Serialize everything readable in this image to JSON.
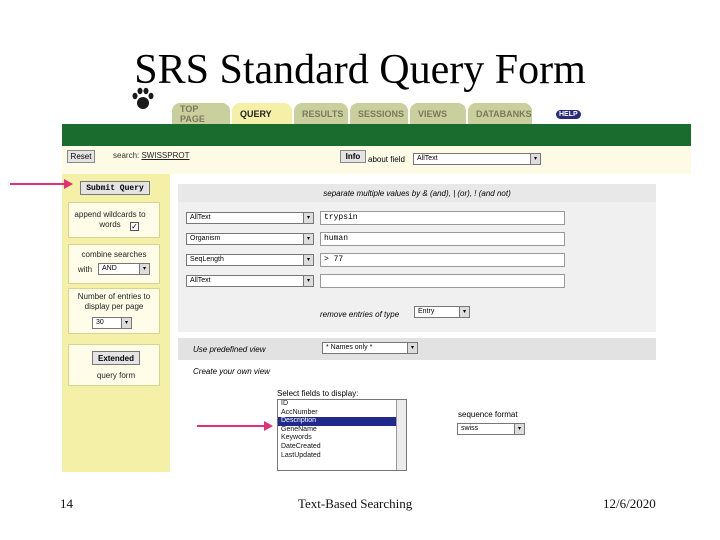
{
  "slide": {
    "title": "SRS Standard Query Form",
    "page_number": "14",
    "center_text": "Text-Based Searching",
    "date": "12/6/2020"
  },
  "tabs": [
    "TOP PAGE",
    "QUERY",
    "RESULTS",
    "SESSIONS",
    "VIEWS",
    "DATABANKS"
  ],
  "help_label": "HELP",
  "topbar": {
    "reset_label": "Reset",
    "search_prefix": "search:",
    "search_db": "SWISSPROT",
    "info_label": "Info",
    "about_field_label": "about field",
    "about_field_value": "AllText"
  },
  "sidebar": {
    "submit_label": "Submit Query",
    "append_wildcards_label": "append wildcards to words",
    "append_wildcards_checked": "✓",
    "combine_label": "combine searches",
    "combine_with_label": "with",
    "combine_value": "AND",
    "entries_label": "Number of entries to display per page",
    "entries_value": "30",
    "extended_label": "Extended",
    "extended_suffix": "query form"
  },
  "query": {
    "hint": "separate multiple values by & (and), | (or), ! (and not)",
    "rows": [
      {
        "field": "AllText",
        "value": "trypsin"
      },
      {
        "field": "Organism",
        "value": "human"
      },
      {
        "field": "SeqLength",
        "value": "> 77"
      },
      {
        "field": "AllText",
        "value": ""
      }
    ],
    "remove_label": "remove entries of type",
    "remove_value": "Entry"
  },
  "view": {
    "predefined_label": "Use predefined view",
    "predefined_value": "* Names only *",
    "create_label": "Create your own view",
    "select_fields_label": "Select fields to display:",
    "fields": [
      "ID",
      "AccNumber",
      "Description",
      "GeneName",
      "Keywords",
      "DateCreated",
      "LastUpdated"
    ],
    "selected_field_index": 2,
    "seq_format_label": "sequence format",
    "seq_format_value": "swiss"
  },
  "colors": {
    "green_bar": "#1a6b2e",
    "sidebar_yellow": "#f4f0a8",
    "arrow_pink": "#e0307a",
    "selected_blue": "#1f2a8c"
  }
}
